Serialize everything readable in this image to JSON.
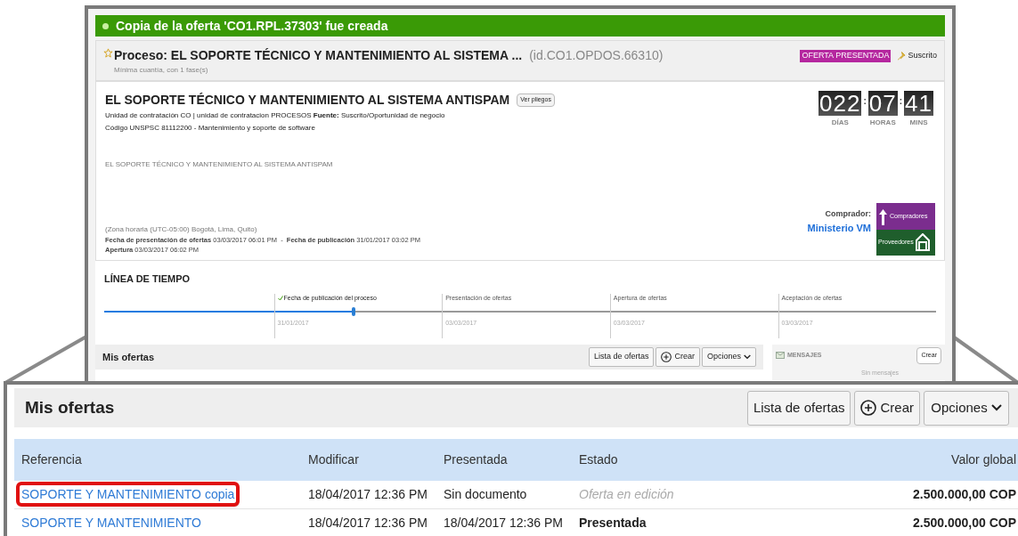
{
  "banner": {
    "text": "Copia de la oferta 'CO1.RPL.37303' fue creada"
  },
  "process": {
    "title": "Proceso: EL SOPORTE TÉCNICO Y MANTENIMIENTO AL SISTEMA ...",
    "id": "(id.CO1.OPDOS.66310)",
    "subtitle": "Mínima cuantía, con 1 fase(s)",
    "status_badge": "OFERTA PRESENTADA",
    "subscribed_label": "Suscrito"
  },
  "detail": {
    "title": "EL SOPORTE TÉCNICO Y MANTENIMIENTO AL SISTEMA ANTISPAM",
    "view_button": "Ver pliegos",
    "line_1": "Unidad de contratación CO | unidad de contratacion PROCESOS **Fuente:** Suscrito/Oportunidad de negocio",
    "line_2": "Código UNSPSC 81112200 - Mantenimiento y soporte de software",
    "description": "EL SOPORTE TÉCNICO Y MANTENIMIENTO AL SISTEMA ANTISPAM",
    "timezone": "(Zona horaria (UTC-05:00) Bogotá, Lima, Quito)",
    "dates_1": "**Fecha de presentación de ofertas** 03/03/2017 06:01 PM  -  **Fecha de publicación** 31/01/2017 03:02 PM",
    "dates_2": "**Apertura** 03/03/2017 06:02 PM",
    "countdown": [
      {
        "value": "022",
        "label": "DÍAS"
      },
      {
        "separator": ":",
        "value": "07",
        "label": "HORAS"
      },
      {
        "separator": ":",
        "value": "41",
        "label": "MINS"
      }
    ],
    "buyer_label": "Comprador:",
    "buyer_name": "Ministerio VM",
    "logo_top": "Compradores",
    "logo_bottom": "Proveedores"
  },
  "timeline": {
    "title": "LÍNEA DE TIEMPO",
    "level": 0.3,
    "milestones": [
      {
        "label": "Fecha de publicación del proceso",
        "date": "31/01/2017",
        "done": true
      },
      {
        "label": "Presentación de ofertas",
        "date": "03/03/2017",
        "done": false
      },
      {
        "label": "Apertura de ofertas",
        "date": "03/03/2017",
        "done": false
      },
      {
        "label": "Aceptación de ofertas",
        "date": "03/03/2017",
        "done": false
      }
    ]
  },
  "offers_small": {
    "title": "Mis ofertas",
    "buttons": [
      "Lista de ofertas",
      "Crear",
      "Opciones"
    ]
  },
  "messages": {
    "title": "MENSAJES",
    "button": "Crear",
    "empty": "Sin mensajes"
  },
  "offers": {
    "title": "Mis ofertas",
    "buttons": [
      "Lista de ofertas",
      "Crear",
      "Opciones"
    ],
    "columns": [
      "Referencia",
      "Modificar",
      "Presentada",
      "Estado",
      "Valor global"
    ],
    "rows": [
      {
        "reference": "SOPORTE Y MANTENIMIENTO copia",
        "modified": "18/04/2017 12:36 PM",
        "submitted": "Sin documento",
        "status": "Oferta en edición",
        "kind": "draft",
        "value": "2.500.000,00 COP",
        "highlighted": true
      },
      {
        "reference": "SOPORTE Y MANTENIMIENTO",
        "modified": "18/04/2017 12:36 PM",
        "submitted": "18/04/2017 12:36 PM",
        "status": "Presentada",
        "kind": "submitted",
        "value": "2.500.000,00 COP",
        "highlighted": false
      }
    ]
  }
}
